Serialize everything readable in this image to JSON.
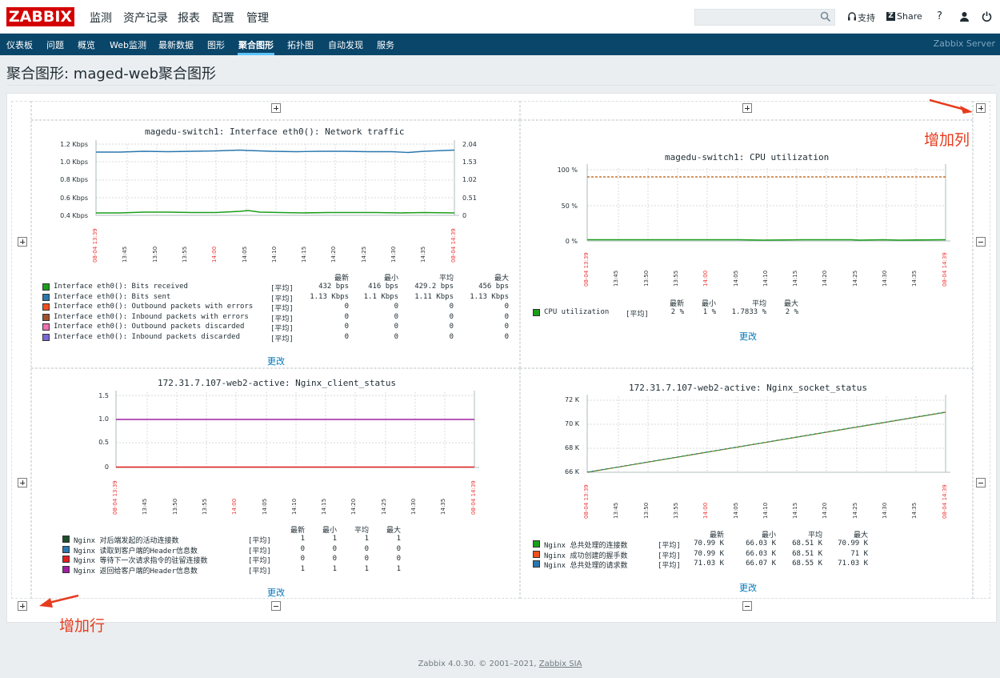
{
  "header": {
    "logo": "ZABBIX",
    "menu": [
      "监测",
      "资产记录",
      "报表",
      "配置",
      "管理"
    ],
    "support": "支持",
    "share": "Share",
    "help": "?"
  },
  "subnav": {
    "items": [
      "仪表板",
      "问题",
      "概览",
      "Web监测",
      "最新数据",
      "图形",
      "聚合图形",
      "拓扑图",
      "自动发现",
      "服务"
    ],
    "active": "聚合图形",
    "server": "Zabbix Server"
  },
  "page": {
    "title": "聚合图形: maged-web聚合图形"
  },
  "annotations": {
    "add_column": "增加列",
    "add_row": "增加行"
  },
  "change_label": "更改",
  "stats_headers": [
    "最新",
    "最小",
    "平均",
    "最大"
  ],
  "avg_tag": "[平均]",
  "graphs": {
    "g1": {
      "title": "magedu-switch1: Interface eth0(): Network traffic",
      "y_left": [
        "1.2 Kbps",
        "1.0 Kbps",
        "0.8 Kbps",
        "0.6 Kbps",
        "0.4 Kbps"
      ],
      "y_right": [
        "2.04",
        "1.53",
        "1.02",
        "0.51",
        "0"
      ],
      "x_ticks": [
        "08-04 13:39",
        "13:45",
        "13:50",
        "13:55",
        "14:00",
        "14:05",
        "14:10",
        "14:15",
        "14:20",
        "14:25",
        "14:30",
        "14:35",
        "08-04 14:39"
      ],
      "legend": [
        {
          "name": "Interface eth0(): Bits received",
          "color": "#1a9e1a",
          "last": "432 bps",
          "min": "416 bps",
          "avg": "429.2 bps",
          "max": "456 bps"
        },
        {
          "name": "Interface eth0(): Bits sent",
          "color": "#2a77ae",
          "last": "1.13 Kbps",
          "min": "1.1 Kbps",
          "avg": "1.11 Kbps",
          "max": "1.13 Kbps"
        },
        {
          "name": "Interface eth0(): Outbound packets with errors",
          "color": "#f0501e",
          "last": "0",
          "min": "0",
          "avg": "0",
          "max": "0"
        },
        {
          "name": "Interface eth0(): Inbound packets with errors",
          "color": "#a0522d",
          "last": "0",
          "min": "0",
          "avg": "0",
          "max": "0"
        },
        {
          "name": "Interface eth0(): Outbound packets discarded",
          "color": "#f070b0",
          "last": "0",
          "min": "0",
          "avg": "0",
          "max": "0"
        },
        {
          "name": "Interface eth0(): Inbound packets discarded",
          "color": "#7b68d6",
          "last": "0",
          "min": "0",
          "avg": "0",
          "max": "0"
        }
      ]
    },
    "g2": {
      "title": "magedu-switch1: CPU utilization",
      "y_left": [
        "100 %",
        "50 %",
        "0 %"
      ],
      "x_ticks": [
        "08-04 13:39",
        "13:45",
        "13:50",
        "13:55",
        "14:00",
        "14:05",
        "14:10",
        "14:15",
        "14:20",
        "14:25",
        "14:30",
        "14:35",
        "08-04 14:39"
      ],
      "legend": [
        {
          "name": "CPU utilization",
          "color": "#1a9e1a",
          "last": "2 %",
          "min": "1 %",
          "avg": "1.7833 %",
          "max": "2 %"
        }
      ]
    },
    "g3": {
      "title": "172.31.7.107-web2-active: Nginx_client_status",
      "y_left": [
        "1.5",
        "1.0",
        "0.5",
        "0"
      ],
      "x_ticks": [
        "08-04 13:39",
        "13:45",
        "13:50",
        "13:55",
        "14:00",
        "14:05",
        "14:10",
        "14:15",
        "14:20",
        "14:25",
        "14:30",
        "14:35",
        "08-04 14:39"
      ],
      "legend": [
        {
          "name": "Nginx 对后端发起的活动连接数",
          "color": "#1e4d2b",
          "last": "1",
          "min": "1",
          "avg": "1",
          "max": "1"
        },
        {
          "name": "Nginx 读取到客户端的Header信息数",
          "color": "#2a77ae",
          "last": "0",
          "min": "0",
          "avg": "0",
          "max": "0"
        },
        {
          "name": "Nginx 等待下一次请求指令的驻留连接数",
          "color": "#e0201e",
          "last": "0",
          "min": "0",
          "avg": "0",
          "max": "0"
        },
        {
          "name": "Nginx 返回给客户端的Header信息数",
          "color": "#a020a0",
          "last": "1",
          "min": "1",
          "avg": "1",
          "max": "1"
        }
      ]
    },
    "g4": {
      "title": "172.31.7.107-web2-active: Nginx_socket_status",
      "y_left": [
        "72 K",
        "70 K",
        "68 K",
        "66 K"
      ],
      "x_ticks": [
        "08-04 13:39",
        "13:45",
        "13:50",
        "13:55",
        "14:00",
        "14:05",
        "14:10",
        "14:15",
        "14:20",
        "14:25",
        "14:30",
        "14:35",
        "08-04 14:39"
      ],
      "legend": [
        {
          "name": "Nginx 总共处理的连接数",
          "color": "#1a9e1a",
          "last": "70.99 K",
          "min": "66.03 K",
          "avg": "68.51 K",
          "max": "70.99 K"
        },
        {
          "name": "Nginx 成功创建的握手数",
          "color": "#f0501e",
          "last": "70.99 K",
          "min": "66.03 K",
          "avg": "68.51 K",
          "max": "71 K"
        },
        {
          "name": "Nginx 总共处理的请求数",
          "color": "#2a77ae",
          "last": "71.03 K",
          "min": "66.07 K",
          "avg": "68.55 K",
          "max": "71.03 K"
        }
      ]
    }
  },
  "footer": {
    "text": "Zabbix 4.0.30. © 2001–2021, ",
    "link": "Zabbix SIA"
  }
}
